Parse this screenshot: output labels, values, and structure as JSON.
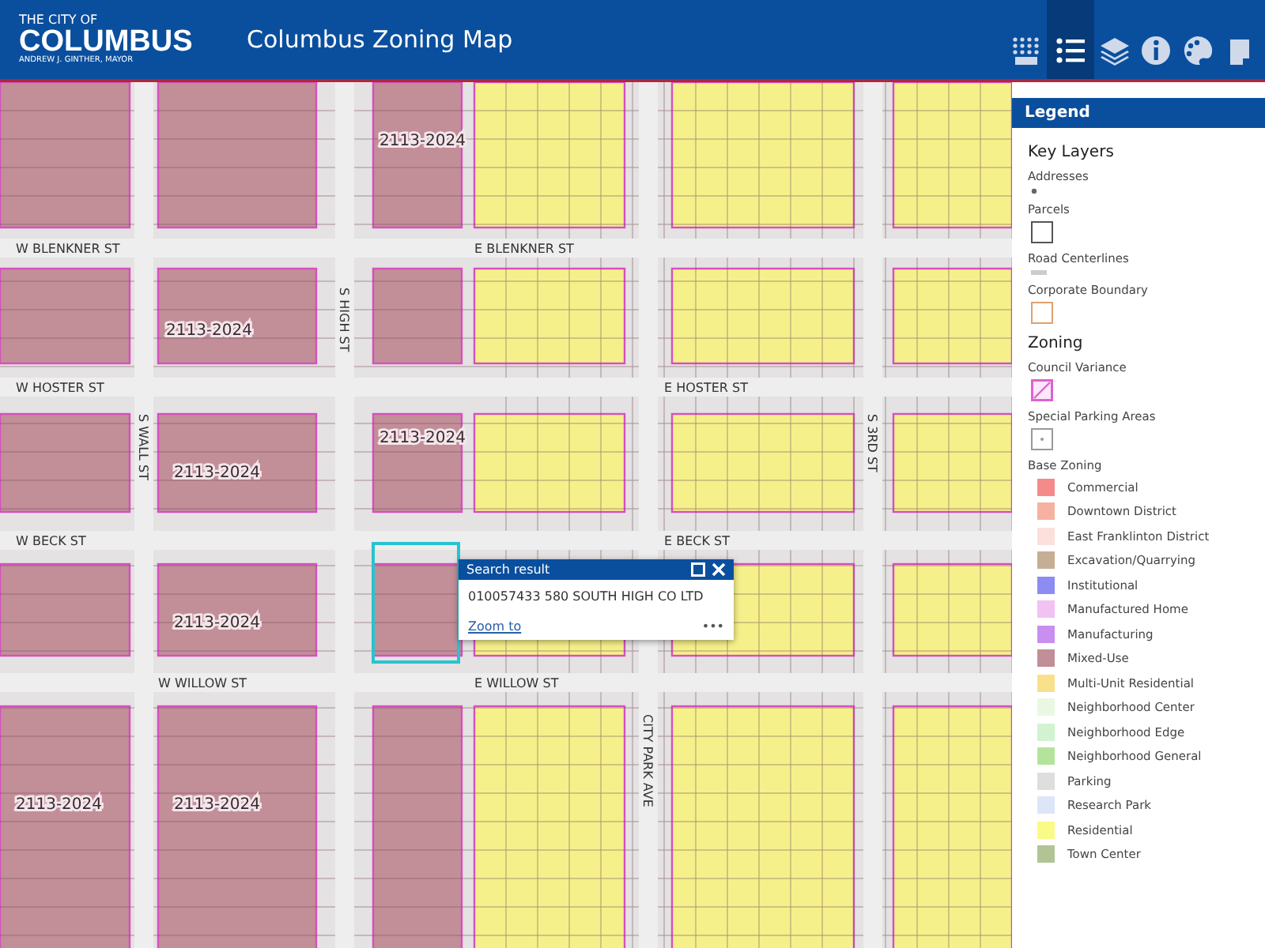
{
  "header": {
    "logo_top": "THE CITY OF",
    "logo_main": "COLUMBUS",
    "logo_sub": "ANDREW J. GINTHER, MAYOR",
    "title": "Columbus Zoning Map"
  },
  "toolbar": [
    {
      "kind": "grid",
      "selected": false
    },
    {
      "kind": "list",
      "selected": true
    },
    {
      "kind": "layers",
      "selected": false
    },
    {
      "kind": "info",
      "selected": false
    },
    {
      "kind": "palette",
      "selected": false
    },
    {
      "kind": "print",
      "selected": false
    }
  ],
  "map": {
    "streets": [
      {
        "name": "W BLENKNER ST",
        "kind": "h"
      },
      {
        "name": "E BLENKNER ST",
        "kind": "h"
      },
      {
        "name": "S HIGH ST",
        "kind": "v"
      },
      {
        "name": "W HOSTER ST",
        "kind": "h"
      },
      {
        "name": "E HOSTER ST",
        "kind": "h"
      },
      {
        "name": "S WALL ST",
        "kind": "v"
      },
      {
        "name": "S 3RD ST",
        "kind": "v"
      },
      {
        "name": "W BECK ST",
        "kind": "h"
      },
      {
        "name": "E BECK ST",
        "kind": "h"
      },
      {
        "name": "W WILLOW ST",
        "kind": "h"
      },
      {
        "name": "E WILLOW ST",
        "kind": "h"
      },
      {
        "name": "CITY PARK AVE",
        "kind": "v"
      }
    ],
    "zone_labels": [
      "2113-2024",
      "2113-2024",
      "2113-2024",
      "2113-2024",
      "2113-2024",
      "2113-2024",
      "2113-2024"
    ]
  },
  "popup": {
    "title": "Search result",
    "text": "010057433 580 SOUTH HIGH CO LTD",
    "link": "Zoom to",
    "more": "•••"
  },
  "legend": {
    "title": "Legend",
    "sections": [
      {
        "heading": "Key Layers",
        "items": [
          {
            "label": "Addresses",
            "kind": "dot"
          },
          {
            "label": "Parcels",
            "kind": "square"
          },
          {
            "label": "Road Centerlines",
            "kind": "line"
          },
          {
            "label": "Corporate Boundary",
            "kind": "orange"
          }
        ]
      },
      {
        "heading": "Zoning",
        "items": [
          {
            "label": "Council Variance",
            "kind": "hatch"
          },
          {
            "label": "Special Parking Areas",
            "kind": "dotsquare"
          }
        ]
      }
    ],
    "base_title": "Base Zoning",
    "base": [
      {
        "label": "Commercial",
        "color": "#f48a8a"
      },
      {
        "label": "Downtown District",
        "color": "#f7b1a1"
      },
      {
        "label": "East Franklinton District",
        "color": "#fbe0dc"
      },
      {
        "label": "Excavation/Quarrying",
        "color": "#c6ae94"
      },
      {
        "label": "Institutional",
        "color": "#8c8cf2"
      },
      {
        "label": "Manufactured Home",
        "color": "#f2c2f2"
      },
      {
        "label": "Manufacturing",
        "color": "#c88ef0"
      },
      {
        "label": "Mixed-Use",
        "color": "#c28e98"
      },
      {
        "label": "Multi-Unit Residential",
        "color": "#f9e08a"
      },
      {
        "label": "Neighborhood Center",
        "color": "#eaf8e2"
      },
      {
        "label": "Neighborhood Edge",
        "color": "#d2f2d0"
      },
      {
        "label": "Neighborhood General",
        "color": "#b4e49c"
      },
      {
        "label": "Parking",
        "color": "#dedede"
      },
      {
        "label": "Research Park",
        "color": "#dde6f8"
      },
      {
        "label": "Residential",
        "color": "#fafa86"
      },
      {
        "label": "Town Center",
        "color": "#b2c496"
      }
    ]
  }
}
